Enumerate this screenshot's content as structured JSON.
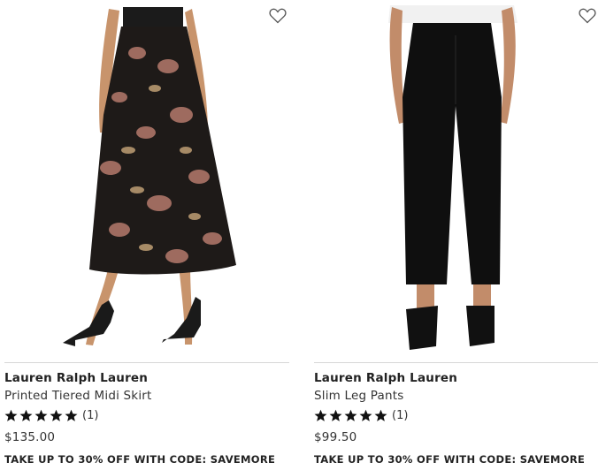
{
  "products": [
    {
      "brand": "Lauren Ralph Lauren",
      "name": "Printed Tiered Midi Skirt",
      "rating_value": 5,
      "rating_max": 5,
      "rating_count": "(1)",
      "price": "$135.00",
      "promo": "TAKE UP TO 30% OFF WITH CODE: SAVEMORE",
      "image_icon": "floral-skirt-image",
      "wishlist_icon": "heart-outline-icon"
    },
    {
      "brand": "Lauren Ralph Lauren",
      "name": "Slim Leg Pants",
      "rating_value": 5,
      "rating_max": 5,
      "rating_count": "(1)",
      "price": "$99.50",
      "promo": "TAKE UP TO 30% OFF WITH CODE: SAVEMORE",
      "image_icon": "black-pants-image",
      "wishlist_icon": "heart-outline-icon"
    }
  ],
  "colors": {
    "star": "#111111",
    "divider": "#d7d7d7",
    "text": "#222222"
  }
}
